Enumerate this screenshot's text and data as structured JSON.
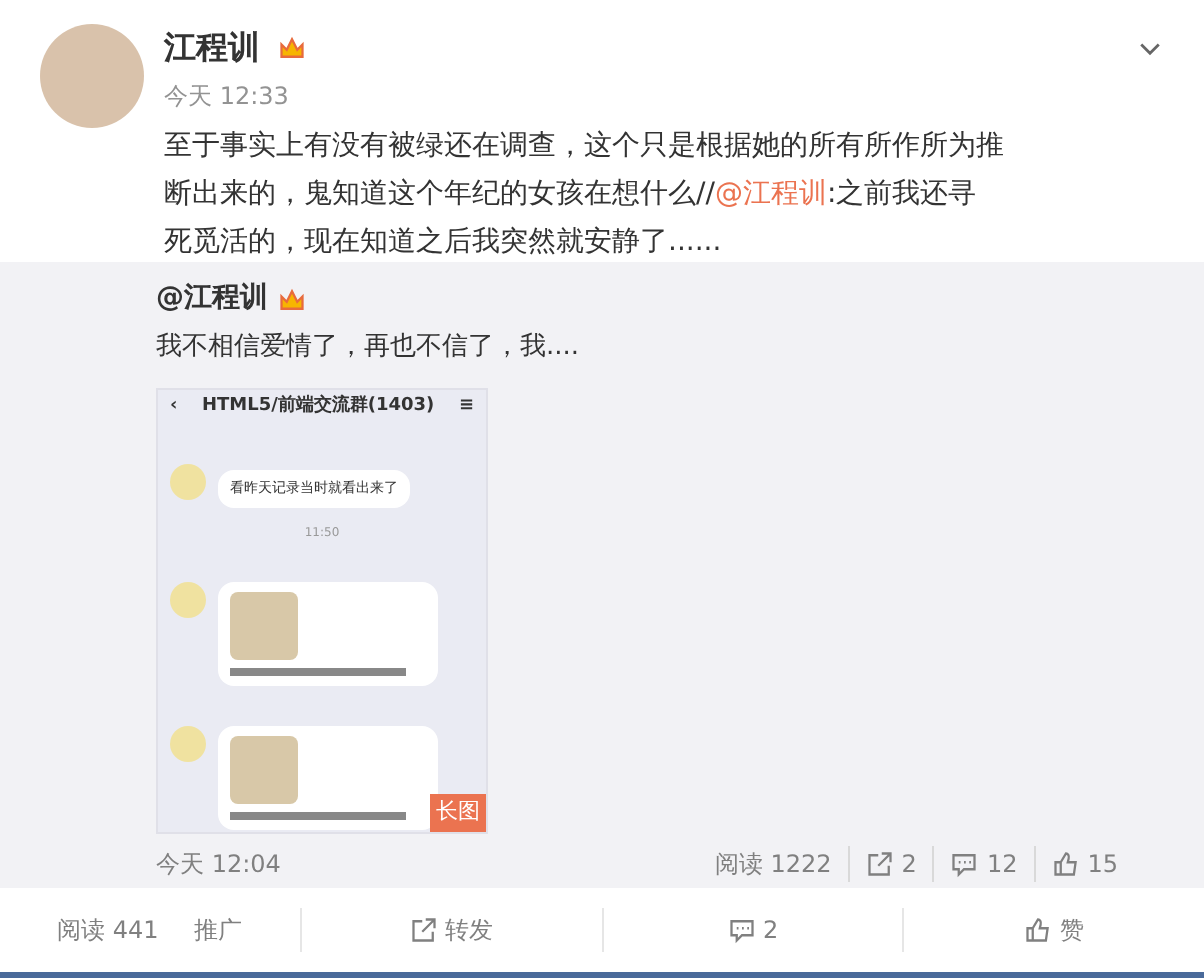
{
  "post": {
    "author": "江程训",
    "time": "今天 12:33",
    "text": "至于事实上有没有被绿还在调查，这个只是根据她的所有所作所为推断出来的，鬼知道这个年纪的女孩在想什么//",
    "mention": "@江程训",
    "text_after": ":之前我还寻死觅活的，现在知道之后我突然就安静了......"
  },
  "repost": {
    "author": "@江程训",
    "text": "我不相信爱情了，再也不信了，我....",
    "image": {
      "title": "HTML5/前端交流群(1403)",
      "back": "‹",
      "menu": "≡",
      "messages": [
        {
          "kind": "text",
          "text": "看昨天记录当时就看出来了"
        },
        {
          "kind": "time",
          "text": "11:50"
        },
        {
          "kind": "image"
        },
        {
          "kind": "image"
        }
      ],
      "badge": "长图"
    },
    "time": "今天 12:04",
    "stats": [
      {
        "kind": "read",
        "text": "阅读 1222"
      },
      {
        "kind": "repost",
        "text": "2"
      },
      {
        "kind": "comment",
        "text": "12"
      },
      {
        "kind": "like",
        "text": "15"
      }
    ]
  },
  "actions": [
    {
      "kind": "read",
      "text": "阅读 441",
      "extra": "推广"
    },
    {
      "kind": "repost",
      "text": "转发"
    },
    {
      "kind": "comment",
      "text": "2"
    },
    {
      "kind": "like",
      "text": "赞"
    }
  ]
}
